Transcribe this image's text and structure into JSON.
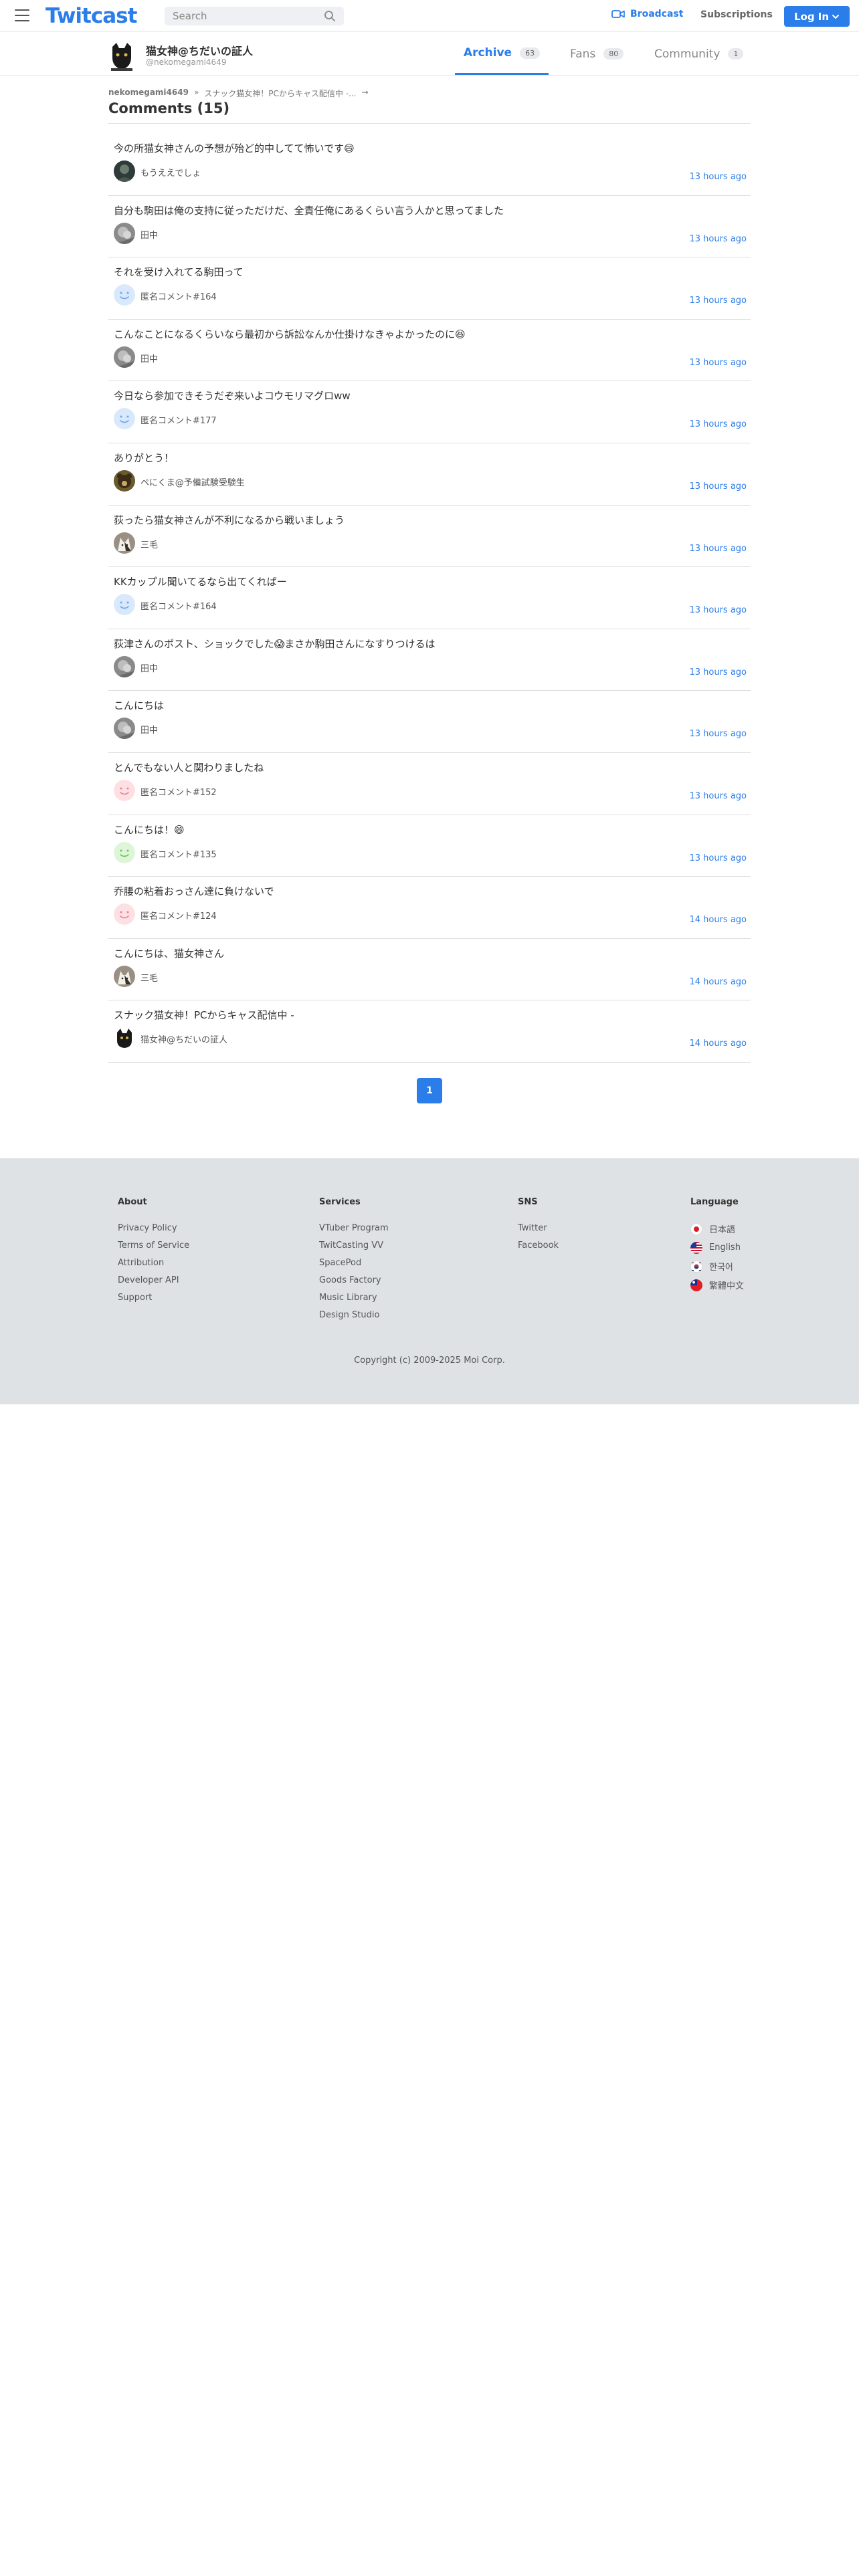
{
  "header": {
    "logo": "Twitcast",
    "search_placeholder": "Search",
    "broadcast_label": "Broadcast",
    "subscriptions_label": "Subscriptions",
    "login_label": "Log In"
  },
  "user": {
    "name": "猫女神@ちだいの証人",
    "id": "@nekomegami4649"
  },
  "tabs": [
    {
      "label": "Archive",
      "count": "63"
    },
    {
      "label": "Fans",
      "count": "80"
    },
    {
      "label": "Community",
      "count": "1"
    }
  ],
  "breadcrumb": {
    "user": "nekomegami4649",
    "sep": "»",
    "item": "スナック猫女神！PCからキャス配信中 -...",
    "arrow": "→"
  },
  "page_title": "Comments (15)",
  "comments": [
    {
      "text": "今の所猫女神さんの予想が殆ど的中してて怖いです😄",
      "author": "もうええでしょ",
      "time": "13 hours ago",
      "avatar": "photo-dark"
    },
    {
      "text": "自分も駒田は俺の支持に従っただけだ、全責任俺にあるくらい言う人かと思ってました",
      "author": "田中",
      "time": "13 hours ago",
      "avatar": "photo-gray"
    },
    {
      "text": "それを受け入れてる駒田って",
      "author": "匿名コメント#164",
      "time": "13 hours ago",
      "avatar": "smiley-blue"
    },
    {
      "text": "こんなことになるくらいなら最初から訴訟なんか仕掛けなきゃよかったのに😆",
      "author": "田中",
      "time": "13 hours ago",
      "avatar": "photo-gray"
    },
    {
      "text": "今日なら参加できそうだぞ来いよコウモリマグロww",
      "author": "匿名コメント#177",
      "time": "13 hours ago",
      "avatar": "smiley-blue"
    },
    {
      "text": "ありがとう！",
      "author": "ペにくま@予備試験受験生",
      "time": "13 hours ago",
      "avatar": "photo-bear"
    },
    {
      "text": "荻ったら猫女神さんが不利になるから戦いましょう",
      "author": "三毛",
      "time": "13 hours ago",
      "avatar": "photo-cat"
    },
    {
      "text": "KKカップル聞いてるなら出てくればー",
      "author": "匿名コメント#164",
      "time": "13 hours ago",
      "avatar": "smiley-blue"
    },
    {
      "text": "荻津さんのポスト、ショックでした😱まさか駒田さんになすりつけるは",
      "author": "田中",
      "time": "13 hours ago",
      "avatar": "photo-gray"
    },
    {
      "text": "こんにちは",
      "author": "田中",
      "time": "13 hours ago",
      "avatar": "photo-gray"
    },
    {
      "text": "とんでもない人と関わりましたね",
      "author": "匿名コメント#152",
      "time": "13 hours ago",
      "avatar": "smiley-pink"
    },
    {
      "text": "こんにちは！😄",
      "author": "匿名コメント#135",
      "time": "13 hours ago",
      "avatar": "smiley-green"
    },
    {
      "text": "乔腰の粘着おっさん達に負けないで",
      "author": "匿名コメント#124",
      "time": "14 hours ago",
      "avatar": "smiley-pink"
    },
    {
      "text": "こんにちは、猫女神さん",
      "author": "三毛",
      "time": "14 hours ago",
      "avatar": "photo-cat"
    },
    {
      "text": "スナック猫女神！PCからキャス配信中 -",
      "author": "猫女神@ちだいの証人",
      "time": "14 hours ago",
      "avatar": "photo-catblack"
    }
  ],
  "pagination": {
    "current": "1"
  },
  "footer": {
    "about": {
      "title": "About",
      "links": [
        "Privacy Policy",
        "Terms of Service",
        "Attribution",
        "Developer API",
        "Support"
      ]
    },
    "services": {
      "title": "Services",
      "links": [
        "VTuber Program",
        "TwitCasting VV",
        "SpacePod",
        "Goods Factory",
        "Music Library",
        "Design Studio"
      ]
    },
    "sns": {
      "title": "SNS",
      "links": [
        "Twitter",
        "Facebook"
      ]
    },
    "language": {
      "title": "Language",
      "items": [
        {
          "label": "日本語",
          "flag": "jp-flag"
        },
        {
          "label": "English",
          "flag": "us-flag"
        },
        {
          "label": "한국어",
          "flag": "kr-flag"
        },
        {
          "label": "繁體中文",
          "flag": "tw-flag"
        }
      ]
    },
    "copyright": "Copyright (c) 2009-2025 Moi Corp."
  },
  "colors": {
    "accent": "#2b7de9",
    "footer_bg": "#dfe2e5",
    "divider": "#dddddd"
  }
}
